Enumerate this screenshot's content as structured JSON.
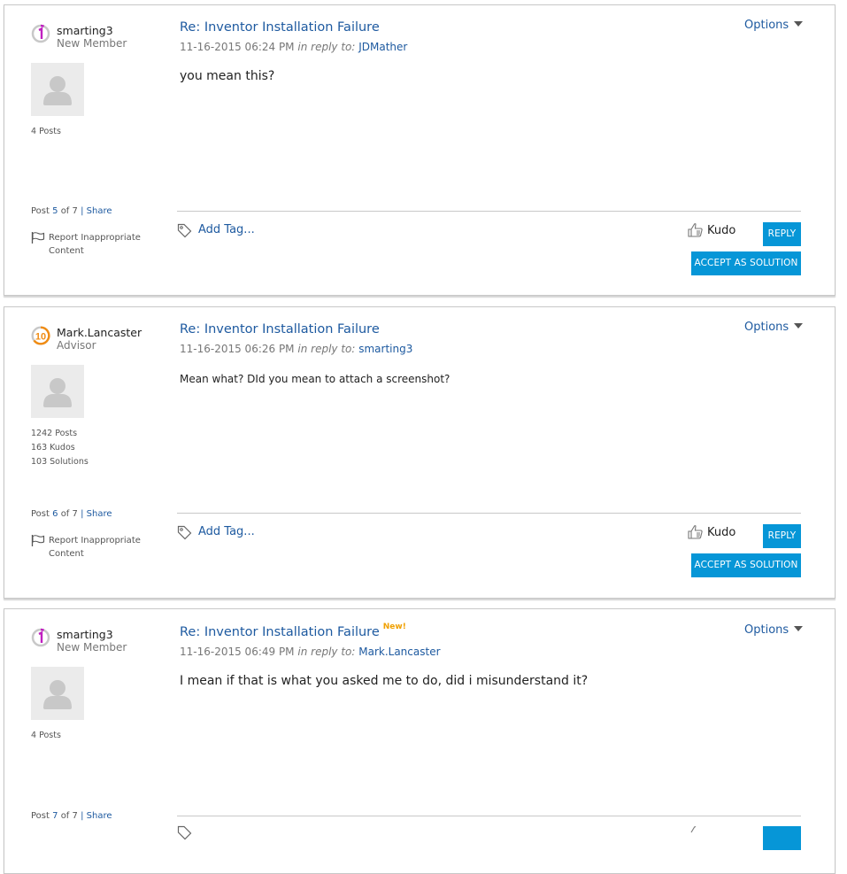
{
  "colors": {
    "link": "#1e5aa0",
    "button": "#0696d7",
    "new_badge": "#f0a000",
    "rank_new_member": "#c020c0",
    "rank_advisor": "#f08c14"
  },
  "posts": [
    {
      "author": {
        "name": "smarting3",
        "role": "New Member",
        "rank_icon": "rank-1-icon",
        "rank_label": "1"
      },
      "stats": [
        "4 Posts"
      ],
      "title": "Re: Inventor Installation Failure",
      "new_badge": "",
      "datetime": "11-16-2015 06:24 PM",
      "in_reply_label": "in reply to:",
      "in_reply_to": "JDMather",
      "body": "you mean this?",
      "options_label": "Options",
      "post_position": {
        "prefix": "Post",
        "current": "5",
        "of": "of",
        "total": "7",
        "separator": "|",
        "share": "Share"
      },
      "report_label": "Report Inappropriate Content",
      "add_tag_label": "Add Tag...",
      "kudo_label": "Kudo",
      "reply_label": "REPLY",
      "accept_label": "ACCEPT AS SOLUTION"
    },
    {
      "author": {
        "name": "Mark.Lancaster",
        "role": "Advisor",
        "rank_icon": "rank-10-icon",
        "rank_label": "10"
      },
      "stats": [
        "1242 Posts",
        "163 Kudos",
        "103 Solutions"
      ],
      "title": "Re: Inventor Installation Failure",
      "new_badge": "",
      "datetime": "11-16-2015 06:26 PM",
      "in_reply_label": "in reply to:",
      "in_reply_to": "smarting3",
      "body": "Mean what?  DId you mean to attach a screenshot?",
      "options_label": "Options",
      "post_position": {
        "prefix": "Post",
        "current": "6",
        "of": "of",
        "total": "7",
        "separator": "|",
        "share": "Share"
      },
      "report_label": "Report Inappropriate Content",
      "add_tag_label": "Add Tag...",
      "kudo_label": "Kudo",
      "reply_label": "REPLY",
      "accept_label": "ACCEPT AS SOLUTION"
    },
    {
      "author": {
        "name": "smarting3",
        "role": "New Member",
        "rank_icon": "rank-1-icon",
        "rank_label": "1"
      },
      "stats": [
        "4 Posts"
      ],
      "title": "Re: Inventor Installation Failure",
      "new_badge": "New!",
      "datetime": "11-16-2015 06:49 PM",
      "in_reply_label": "in reply to:",
      "in_reply_to": "Mark.Lancaster",
      "body": "I mean if that is what you asked me to do, did i misunderstand it?",
      "options_label": "Options",
      "post_position": {
        "prefix": "Post",
        "current": "7",
        "of": "of",
        "total": "7",
        "separator": "|",
        "share": "Share"
      }
    }
  ]
}
